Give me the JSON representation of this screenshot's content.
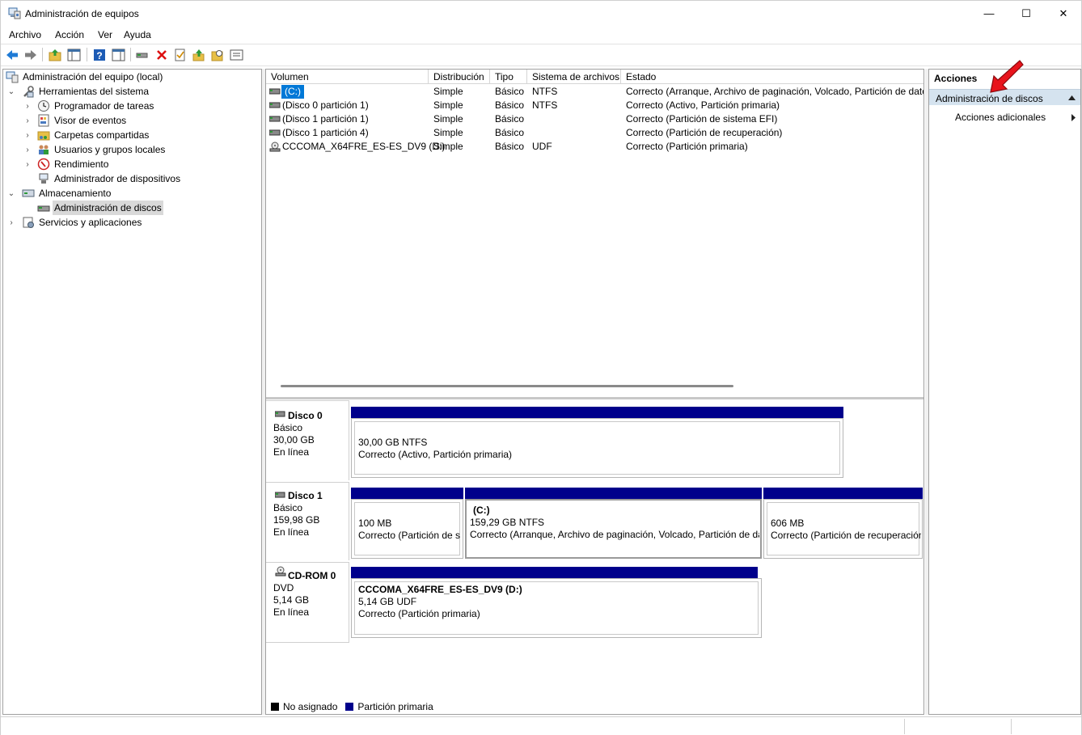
{
  "window": {
    "title": "Administración de equipos",
    "controls": {
      "minimize": "—",
      "maximize": "☐",
      "close": "✕"
    }
  },
  "menu": [
    "Archivo",
    "Acción",
    "Ver",
    "Ayuda"
  ],
  "toolbar": {
    "icons": [
      "back-icon",
      "forward-icon",
      "up-folder-icon",
      "show-hide-tree-icon",
      "help-icon",
      "properties-pane-icon",
      "connect-icon",
      "delete-icon",
      "checklist-icon",
      "export-icon",
      "search-icon",
      "list-icon"
    ]
  },
  "tree": {
    "root": "Administración del equipo (local)",
    "items": [
      {
        "label": "Herramientas del sistema",
        "level": 1,
        "expanded": true
      },
      {
        "label": "Programador de tareas",
        "level": 2,
        "collapsed": true
      },
      {
        "label": "Visor de eventos",
        "level": 2,
        "collapsed": true
      },
      {
        "label": "Carpetas compartidas",
        "level": 2,
        "collapsed": true
      },
      {
        "label": "Usuarios y grupos locales",
        "level": 2,
        "collapsed": true
      },
      {
        "label": "Rendimiento",
        "level": 2,
        "collapsed": true
      },
      {
        "label": "Administrador de dispositivos",
        "level": 2
      },
      {
        "label": "Almacenamiento",
        "level": 1,
        "expanded": true
      },
      {
        "label": "Administración de discos",
        "level": 2,
        "selected": true
      },
      {
        "label": "Servicios y aplicaciones",
        "level": 1,
        "collapsed": true
      }
    ]
  },
  "volumes": {
    "columns": [
      "Volumen",
      "Distribución",
      "Tipo",
      "Sistema de archivos",
      "Estado"
    ],
    "rows": [
      {
        "volume": "(C:)",
        "layout": "Simple",
        "type": "Básico",
        "fs": "NTFS",
        "status": "Correcto (Arranque, Archivo de paginación, Volcado, Partición de datos básicos)",
        "selected": true
      },
      {
        "volume": "(Disco 0 partición 1)",
        "layout": "Simple",
        "type": "Básico",
        "fs": "NTFS",
        "status": "Correcto (Activo, Partición primaria)"
      },
      {
        "volume": "(Disco 1 partición 1)",
        "layout": "Simple",
        "type": "Básico",
        "fs": "",
        "status": "Correcto (Partición de sistema EFI)"
      },
      {
        "volume": "(Disco 1 partición 4)",
        "layout": "Simple",
        "type": "Básico",
        "fs": "",
        "status": "Correcto (Partición de recuperación)"
      },
      {
        "volume": "CCCOMA_X64FRE_ES-ES_DV9 (D:)",
        "layout": "Simple",
        "type": "Básico",
        "fs": "UDF",
        "status": "Correcto (Partición primaria)"
      }
    ]
  },
  "disks": [
    {
      "name": "Disco 0",
      "type": "Básico",
      "size": "30,00 GB",
      "state": "En línea",
      "partitions": [
        {
          "title": "",
          "size": "30,00 GB NTFS",
          "status": "Correcto (Activo, Partición primaria)"
        }
      ]
    },
    {
      "name": "Disco 1",
      "type": "Básico",
      "size": "159,98 GB",
      "state": "En línea",
      "partitions": [
        {
          "title": "",
          "size": "100 MB",
          "status": "Correcto (Partición de s"
        },
        {
          "title": "(C:)",
          "size": "159,29 GB NTFS",
          "status": "Correcto (Arranque, Archivo de paginación, Volcado, Partición de datos"
        },
        {
          "title": "",
          "size": "606 MB",
          "status": "Correcto (Partición de recuperación"
        }
      ]
    },
    {
      "name": "CD-ROM 0",
      "type": "DVD",
      "size": "5,14 GB",
      "state": "En línea",
      "partitions": [
        {
          "title": "CCCOMA_X64FRE_ES-ES_DV9  (D:)",
          "size": "5,14 GB UDF",
          "status": "Correcto (Partición primaria)"
        }
      ]
    }
  ],
  "legend": [
    {
      "label": "No asignado",
      "color": "#000000"
    },
    {
      "label": "Partición primaria",
      "color": "#00008b"
    }
  ],
  "actions": {
    "title": "Acciones",
    "section": "Administración de discos",
    "item": "Acciones adicionales"
  },
  "colors": {
    "primary_partition": "#00008b",
    "selection_blue": "#0078d7",
    "actions_header": "#d5e3ef",
    "annotation_arrow": "#e8141c"
  }
}
